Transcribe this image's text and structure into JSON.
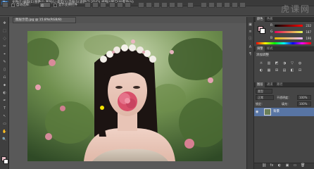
{
  "app": {
    "logo": "Ps"
  },
  "menu": [
    "文件(F)",
    "编辑(E)",
    "图像(I)",
    "图层(L)",
    "类型(Y)",
    "选择(S)",
    "滤镜(T)",
    "3D(D)",
    "视图(V)",
    "窗口(W)",
    "帮助(H)"
  ],
  "options": {
    "auto_select_label": "自动选择：",
    "target_value": "组",
    "transform_controls_label": "显示变换控件"
  },
  "watermark": "虎课网",
  "document": {
    "tab_title": "图层示范.jpg @ 15.8%(RGB/8)"
  },
  "panels": {
    "top_tabs": [
      "颜色",
      "色板"
    ],
    "color": {
      "r_label": "R",
      "r_value": "232",
      "g_label": "G",
      "g_value": "187",
      "b_label": "B",
      "b_value": "196"
    },
    "adj_tabs": [
      "调整",
      "样式"
    ],
    "adj_heading": "添加调整",
    "layers_tabs": [
      "图层",
      "通道",
      "路径"
    ],
    "layers_filter": "类型",
    "blend_mode": "正常",
    "opacity_label": "不透明度：",
    "opacity_value": "100%",
    "lock_label": "锁定：",
    "fill_label": "填充：",
    "fill_value": "100%",
    "layer": {
      "name": "背景"
    }
  },
  "colors": {
    "foreground": "#e8bcc6",
    "background": "#ffffff",
    "layer_selected": "#5875a4"
  }
}
